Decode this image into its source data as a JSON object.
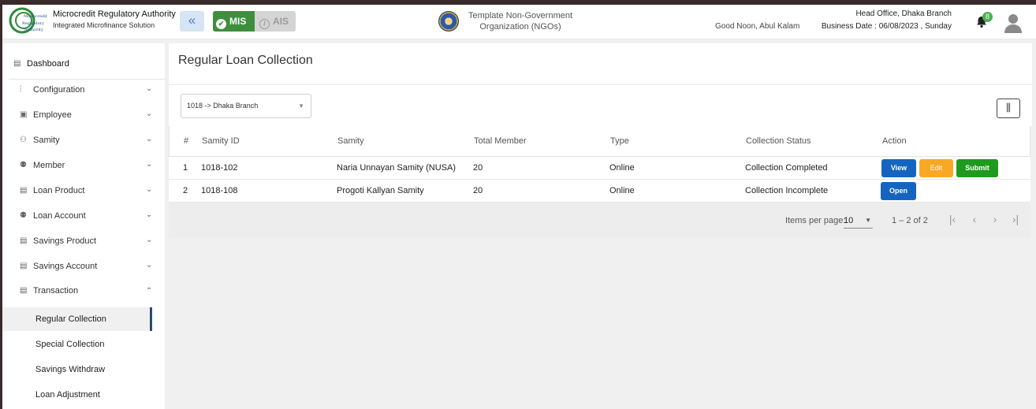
{
  "header": {
    "org_name": "Microcredit Regulatory Authority",
    "org_sub": "Integrated Microfinance Solution",
    "logo_text": [
      "Microcredit",
      "Regulatory",
      "Authority"
    ],
    "mis_label": "MIS",
    "ais_label": "AIS",
    "ngo_name": "Template Non-Government Organization (NGOs)",
    "greeting": "Good Noon, Abul Kalam",
    "branch": "Head Office, Dhaka Branch",
    "business_date": "Business Date : 06/08/2023 , Sunday",
    "notification_count": "8"
  },
  "sidebar": {
    "dashboard": "Dashboard",
    "items": [
      {
        "label": "Configuration",
        "icon": "sliders-icon"
      },
      {
        "label": "Employee",
        "icon": "id-card-icon"
      },
      {
        "label": "Samity",
        "icon": "group-icon"
      },
      {
        "label": "Member",
        "icon": "users-icon"
      },
      {
        "label": "Loan Product",
        "icon": "document-icon"
      },
      {
        "label": "Loan Account",
        "icon": "users-icon"
      },
      {
        "label": "Savings Product",
        "icon": "document-icon"
      },
      {
        "label": "Savings Account",
        "icon": "document-icon"
      },
      {
        "label": "Transaction",
        "icon": "document-icon"
      }
    ],
    "sub_items": [
      "Regular Collection",
      "Special Collection",
      "Savings Withdraw",
      "Loan Adjustment"
    ]
  },
  "main": {
    "title": "Regular Loan Collection",
    "branch_select": "1018 -> Dhaka Branch",
    "table": {
      "headers": [
        "#",
        "Samity ID",
        "Samity",
        "Total Member",
        "Type",
        "Collection Status",
        "Action"
      ],
      "rows": [
        {
          "num": "1",
          "samity_id": "1018-102",
          "samity": "Naria Unnayan Samity (NUSA)",
          "members": "20",
          "type": "Online",
          "status": "Collection Completed"
        },
        {
          "num": "2",
          "samity_id": "1018-108",
          "samity": "Progoti Kallyan Samity",
          "members": "20",
          "type": "Online",
          "status": "Collection Incomplete"
        }
      ],
      "actions": {
        "view": "View",
        "edit": "Edit",
        "submit": "Submit",
        "open": "Open"
      }
    },
    "paginator": {
      "items_per_page_label": "Items per page:",
      "page_size": "10",
      "range": "1 – 2 of 2"
    }
  },
  "colors": {
    "view": "#1565c0",
    "edit": "#f9a825",
    "submit": "#1e9a1e",
    "mis": "#3d8f3d",
    "sidebar_active": "#2c4a73"
  }
}
